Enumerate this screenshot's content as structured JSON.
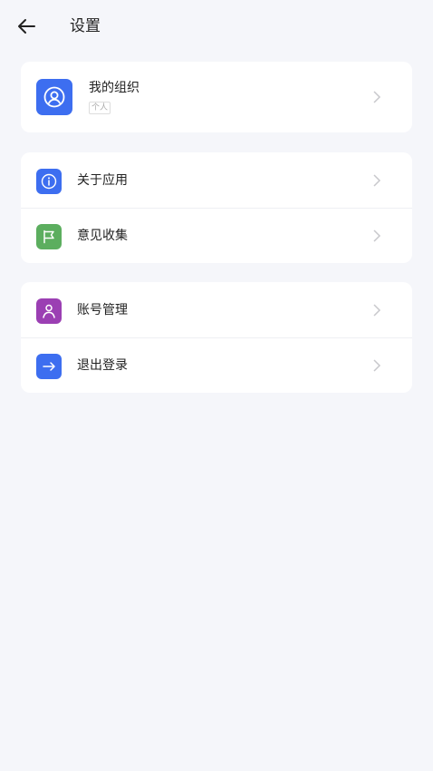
{
  "header": {
    "title": "设置"
  },
  "org": {
    "name": "我的组织",
    "tag": "个人"
  },
  "group1": [
    {
      "label": "关于应用",
      "icon": "info-icon",
      "color": "#3d6ef0"
    },
    {
      "label": "意见收集",
      "icon": "flag-icon",
      "color": "#5cae5f"
    }
  ],
  "group2": [
    {
      "label": "账号管理",
      "icon": "user-icon",
      "color": "#9b3fb3"
    },
    {
      "label": "退出登录",
      "icon": "logout-arrow-icon",
      "color": "#3d6ef0"
    }
  ]
}
